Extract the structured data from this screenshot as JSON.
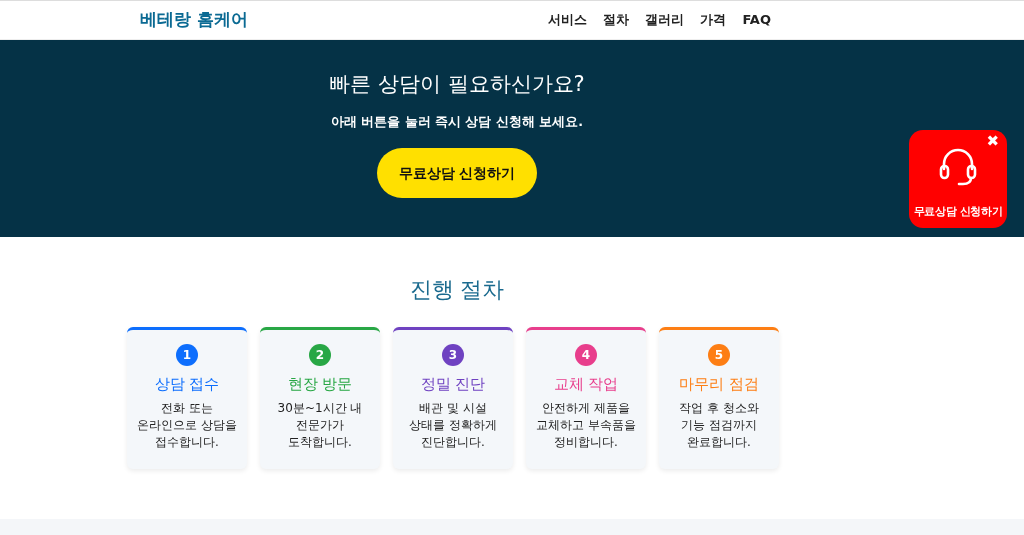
{
  "navbar": {
    "brand": "베테랑 홈케어",
    "links": [
      "서비스",
      "절차",
      "갤러리",
      "가격",
      "FAQ"
    ]
  },
  "hero": {
    "title": "빠른 상담이 필요하신가요?",
    "subtitle": "아래 버튼을 눌러 즉시 상담 신청해 보세요.",
    "button": "무료상담 신청하기"
  },
  "floating_button": {
    "label": "무료상담 신청하기",
    "close": "✖"
  },
  "process": {
    "title": "진행 절차",
    "steps": [
      {
        "number": "1",
        "title": "상담 접수",
        "text": "전화 또는 온라인으로 상담을 접수합니다.",
        "color": "#0d6efd"
      },
      {
        "number": "2",
        "title": "현장 방문",
        "text": "30분~1시간 내 전문가가 도착합니다.",
        "color": "#28a745"
      },
      {
        "number": "3",
        "title": "정밀 진단",
        "text": "배관 및 시설 상태를 정확하게 진단합니다.",
        "color": "#6f42c1"
      },
      {
        "number": "4",
        "title": "교체 작업",
        "text": "안전하게 제품을 교체하고 부속품을 정비합니다.",
        "color": "#e83e8c"
      },
      {
        "number": "5",
        "title": "마무리 점검",
        "text": "작업 후 청소와 기능 점검까지 완료합니다.",
        "color": "#fd7e14"
      }
    ]
  }
}
